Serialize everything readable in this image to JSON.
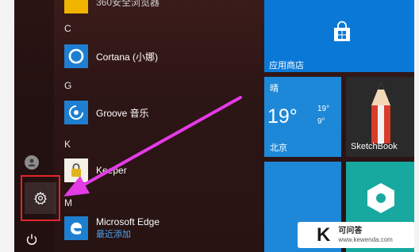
{
  "app_list": {
    "sections": [
      {
        "letter": "C",
        "apps": [
          {
            "label": "Cortana (小娜)"
          }
        ]
      },
      {
        "letter": "G",
        "apps": [
          {
            "label": "Groove 音乐"
          }
        ]
      },
      {
        "letter": "K",
        "apps": [
          {
            "label": "Keeper"
          }
        ]
      },
      {
        "letter": "M",
        "apps": [
          {
            "label": "Microsoft Edge",
            "sub": "最近添加"
          }
        ]
      }
    ],
    "top_partial_label": "360安全浏览器"
  },
  "tiles": {
    "store": {
      "label": "应用商店",
      "color": "#0a78d7"
    },
    "weather": {
      "condition": "晴",
      "temp": "19°",
      "high": "19°",
      "low": "9°",
      "city": "北京",
      "color": "#1e88d8"
    },
    "sketchbook": {
      "label": "SketchBook",
      "color": "#2a2a2a"
    },
    "hex_app": {
      "color": "#17a8a0"
    },
    "bottom_left": {
      "color": "#1e88d8"
    }
  },
  "colors": {
    "highlight_border": "#e0262b",
    "arrow": "#e33be6"
  },
  "watermark": {
    "logo": "K",
    "title": "可问答",
    "url": "www.kewenda.com"
  }
}
